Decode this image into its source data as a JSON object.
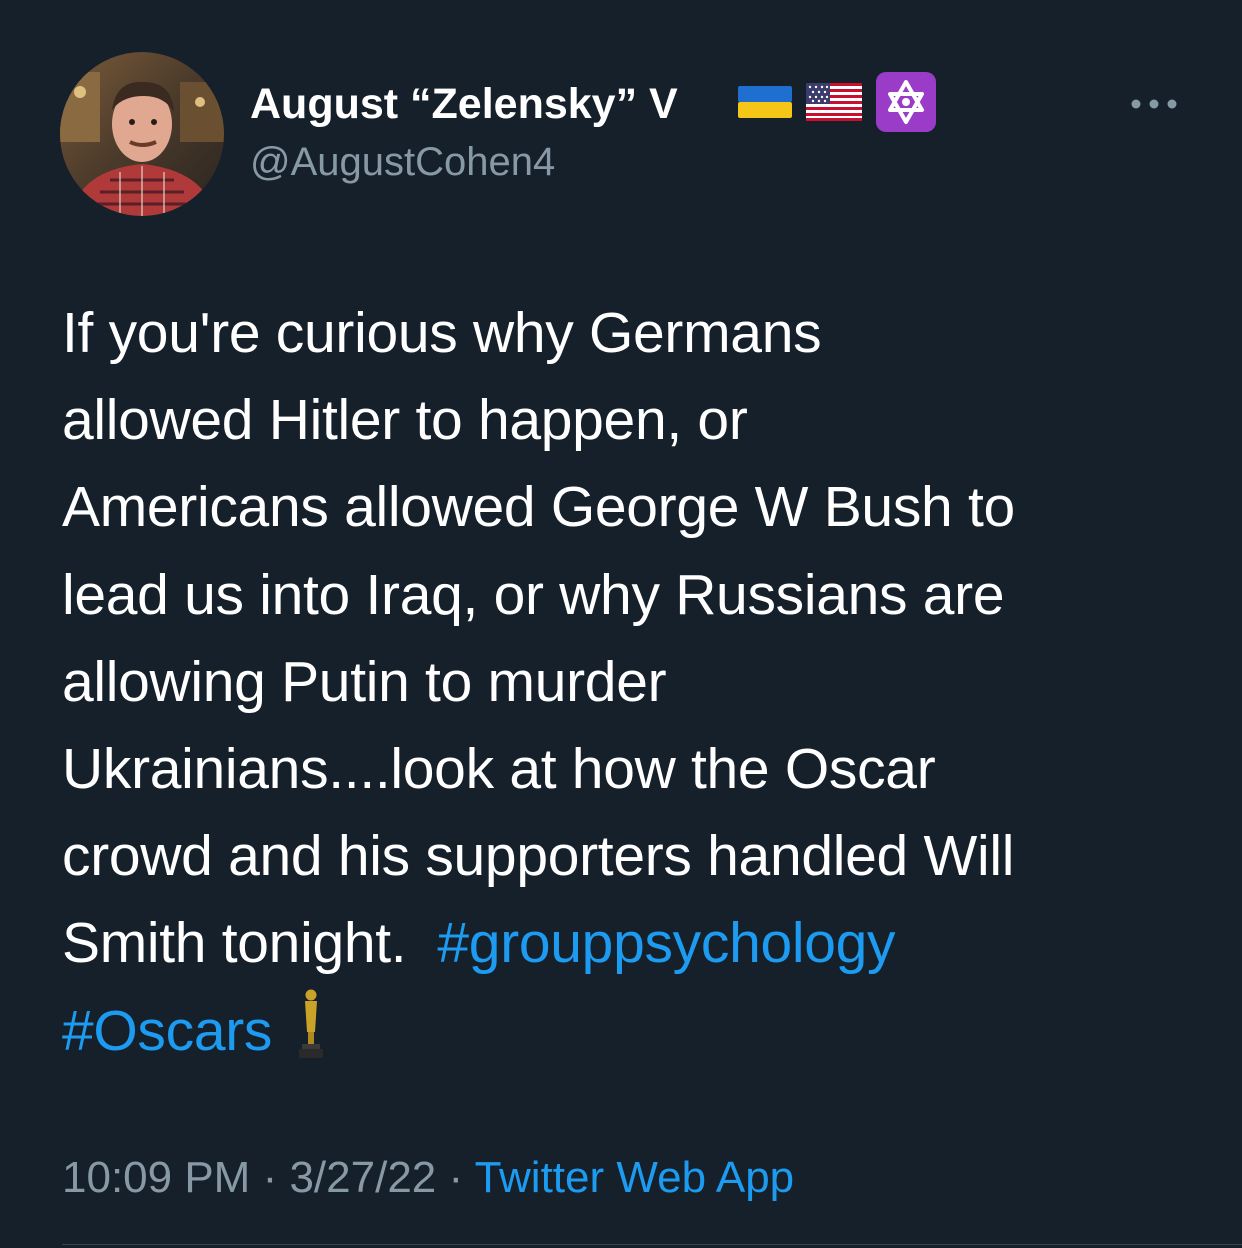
{
  "author": {
    "display_name": "August “Zelensky” V",
    "handle": "@AugustCohen4",
    "badges": [
      "ukraine-flag-icon",
      "us-flag-icon",
      "star-of-david-icon"
    ]
  },
  "tweet": {
    "lines": [
      "If you're curious why Germans",
      "allowed Hitler to happen, or",
      "Americans allowed George W Bush to",
      "lead us into Iraq, or why Russians are",
      "allowing Putin to murder",
      "Ukrainians....look at how the Oscar",
      "crowd and his supporters handled Will"
    ],
    "line8_text": "Smith tonight.  ",
    "hashtag1": "#grouppsychology",
    "hashtag2": "#Oscars",
    "trailing_emoji": "oscar-statue-icon"
  },
  "meta": {
    "time": "10:09 PM",
    "separator": " · ",
    "date": "3/27/22",
    "source": "Twitter Web App"
  },
  "colors": {
    "background": "#15202b",
    "text": "#ffffff",
    "secondary": "#8899a6",
    "link": "#1d9bf0"
  }
}
